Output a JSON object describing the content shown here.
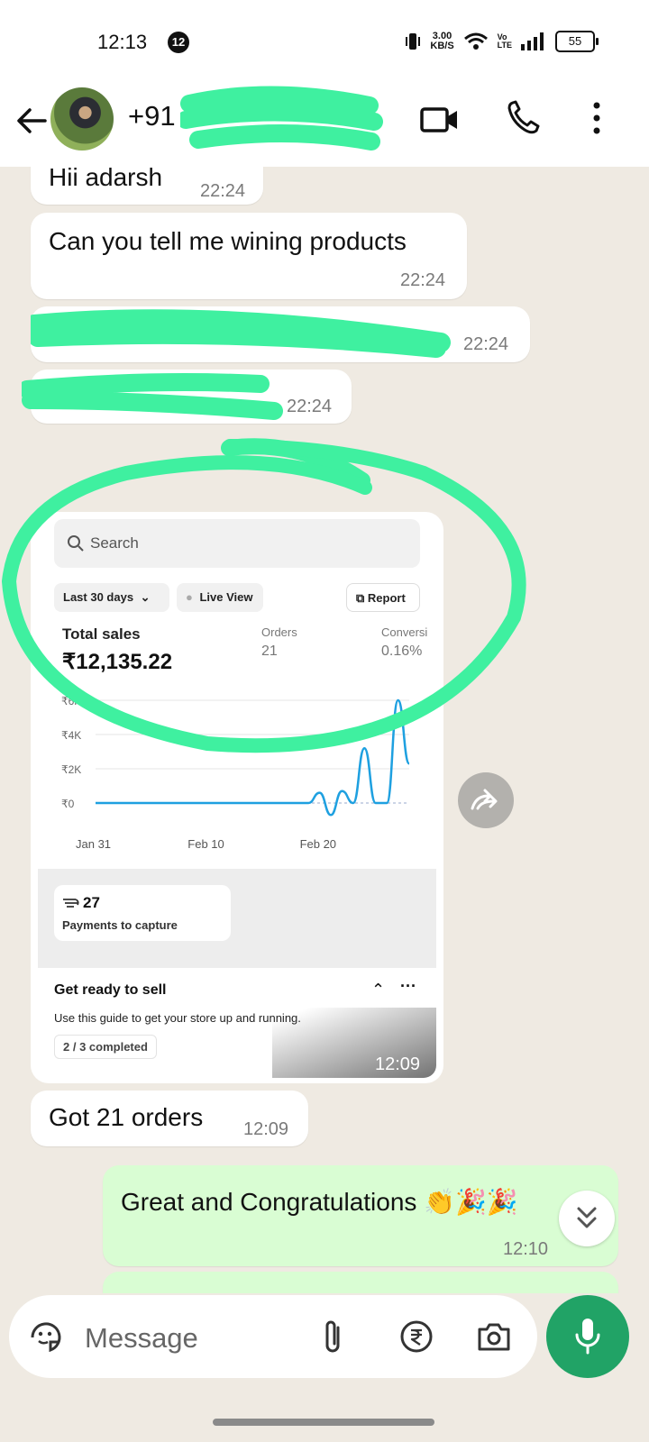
{
  "status_bar": {
    "time": "12:13",
    "notification_count": "12",
    "net_speed_value": "3.00",
    "net_speed_unit": "KB/S",
    "volte_label": "Vo\nLTE",
    "battery": "55"
  },
  "header": {
    "contact_prefix": "+91"
  },
  "messages": [
    {
      "text": "Hii adarsh",
      "time": "22:24"
    },
    {
      "text": "Can you tell me wining products",
      "time": "22:24"
    },
    {
      "text": "",
      "time": "22:24"
    },
    {
      "text": "",
      "time": "22:24"
    },
    {
      "text": "Got 21 orders",
      "time": "12:09"
    },
    {
      "text": "Great and Congratulations 👏🎉🎉",
      "time": "12:10"
    }
  ],
  "image_message": {
    "time": "12:09",
    "search_placeholder": "Search",
    "date_range": "Last 30 days",
    "live_view": "Live View",
    "report": "Report",
    "total_sales_label": "Total sales",
    "total_sales_value": "₹12,135.22",
    "orders_label": "Orders",
    "orders_value": "21",
    "conversion_label": "Conversi",
    "conversion_value": "0.16%",
    "payments_count": "27",
    "payments_label": "Payments to capture",
    "guide_title": "Get ready to sell",
    "guide_desc": "Use this guide to get your store up and running.",
    "guide_progress": "2 / 3 completed"
  },
  "chart_data": {
    "type": "line",
    "y_ticks": [
      "₹6K",
      "₹4K",
      "₹2K",
      "₹0"
    ],
    "x_ticks": [
      "Jan 31",
      "Feb 10",
      "Feb 20"
    ],
    "ylim": [
      0,
      6000
    ],
    "x": [
      "Jan 31",
      "Feb 1",
      "Feb 2",
      "Feb 3",
      "Feb 4",
      "Feb 5",
      "Feb 6",
      "Feb 7",
      "Feb 8",
      "Feb 9",
      "Feb 10",
      "Feb 11",
      "Feb 12",
      "Feb 13",
      "Feb 14",
      "Feb 15",
      "Feb 16",
      "Feb 17",
      "Feb 18",
      "Feb 19",
      "Feb 20",
      "Feb 21",
      "Feb 22",
      "Feb 23",
      "Feb 24",
      "Feb 25",
      "Feb 26",
      "Feb 27",
      "Feb 28"
    ],
    "series": [
      {
        "values": [
          0,
          0,
          0,
          0,
          0,
          0,
          0,
          0,
          0,
          0,
          0,
          0,
          0,
          0,
          0,
          0,
          0,
          0,
          0,
          0,
          600,
          -700,
          700,
          0,
          3200,
          0,
          0,
          6000,
          2300
        ]
      }
    ],
    "color": "#1ea0e0"
  },
  "composer": {
    "placeholder": "Message"
  },
  "colors": {
    "accent_green": "#21a366",
    "outgoing_bubble": "#d9fdd3",
    "redaction_marker": "#3ff0a0"
  }
}
